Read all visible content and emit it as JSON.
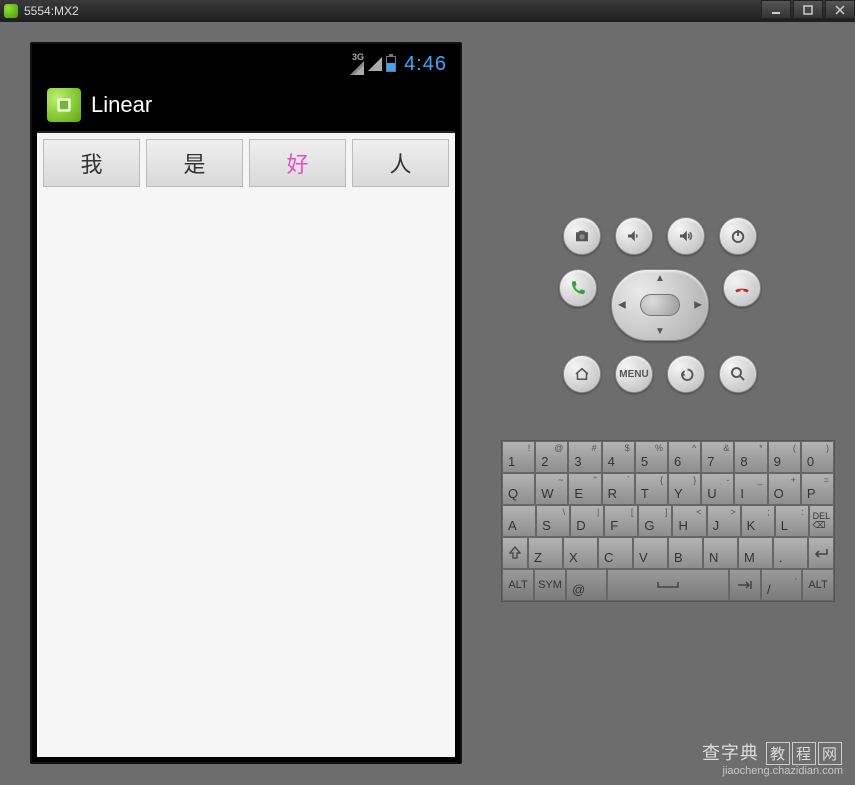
{
  "window": {
    "title": "5554:MX2"
  },
  "statusbar": {
    "net": "3G",
    "clock": "4:46"
  },
  "app": {
    "title": "Linear",
    "buttons": [
      "我",
      "是",
      "好",
      "人"
    ],
    "highlight_index": 2
  },
  "controls": {
    "row1": [
      "camera",
      "volume-down",
      "volume-up",
      "power"
    ],
    "row2_sides": [
      "call",
      "end-call"
    ],
    "row3": [
      "home",
      "menu",
      "back",
      "search"
    ],
    "menu_label": "MENU"
  },
  "keyboard": {
    "r1": [
      {
        "k": "1",
        "s": "!"
      },
      {
        "k": "2",
        "s": "@"
      },
      {
        "k": "3",
        "s": "#"
      },
      {
        "k": "4",
        "s": "$"
      },
      {
        "k": "5",
        "s": "%"
      },
      {
        "k": "6",
        "s": "^"
      },
      {
        "k": "7",
        "s": "&"
      },
      {
        "k": "8",
        "s": "*"
      },
      {
        "k": "9",
        "s": "("
      },
      {
        "k": "0",
        "s": ")"
      }
    ],
    "r2": [
      {
        "k": "Q"
      },
      {
        "k": "W",
        "s": "~"
      },
      {
        "k": "E",
        "s": "\""
      },
      {
        "k": "R",
        "s": "`"
      },
      {
        "k": "T",
        "s": "{"
      },
      {
        "k": "Y",
        "s": "}"
      },
      {
        "k": "U",
        "s": "-"
      },
      {
        "k": "I",
        "s": "_"
      },
      {
        "k": "O",
        "s": "+"
      },
      {
        "k": "P",
        "s": "="
      }
    ],
    "r3": [
      {
        "k": "A"
      },
      {
        "k": "S",
        "s": "\\"
      },
      {
        "k": "D",
        "s": "|"
      },
      {
        "k": "F",
        "s": "["
      },
      {
        "k": "G",
        "s": "]"
      },
      {
        "k": "H",
        "s": "<"
      },
      {
        "k": "J",
        "s": ">"
      },
      {
        "k": "K",
        "s": ";"
      },
      {
        "k": "L",
        "s": ":"
      },
      {
        "k": "DEL",
        "del": true
      }
    ],
    "r4": [
      {
        "k": "⇧",
        "shift": true
      },
      {
        "k": "Z"
      },
      {
        "k": "X"
      },
      {
        "k": "C"
      },
      {
        "k": "V"
      },
      {
        "k": "B"
      },
      {
        "k": "N"
      },
      {
        "k": "M"
      },
      {
        "k": "."
      },
      {
        "k": "↵",
        "enter": true
      }
    ],
    "r5": {
      "alt": "ALT",
      "sym": "SYM",
      "at": "@",
      "slash": "/",
      "comma": ",",
      "alt2": "ALT"
    }
  },
  "watermark": {
    "brand": "查字典",
    "suffix_chars": [
      "教",
      "程",
      "网"
    ],
    "url": "jiaocheng.chazidian.com"
  }
}
